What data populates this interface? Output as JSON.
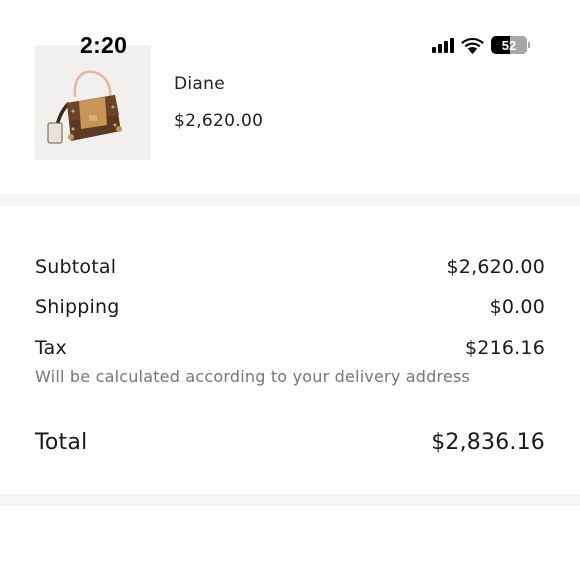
{
  "status_bar": {
    "time": "2:20",
    "battery": "52",
    "icons": [
      "signal-icon",
      "wifi-icon",
      "battery-icon"
    ]
  },
  "product": {
    "name": "Diane",
    "price": "$2,620.00",
    "image": "handbag-image"
  },
  "summary": {
    "subtotal_label": "Subtotal",
    "subtotal_value": "$2,620.00",
    "shipping_label": "Shipping",
    "shipping_value": "$0.00",
    "tax_label": "Tax",
    "tax_value": "$216.16",
    "tax_note": "Will be calculated according to your delivery address",
    "total_label": "Total",
    "total_value": "$2,836.16"
  },
  "colors": {
    "background": "#ffffff",
    "divider": "#f5f5f5",
    "text": "#1a1a1a",
    "muted": "#777777"
  }
}
